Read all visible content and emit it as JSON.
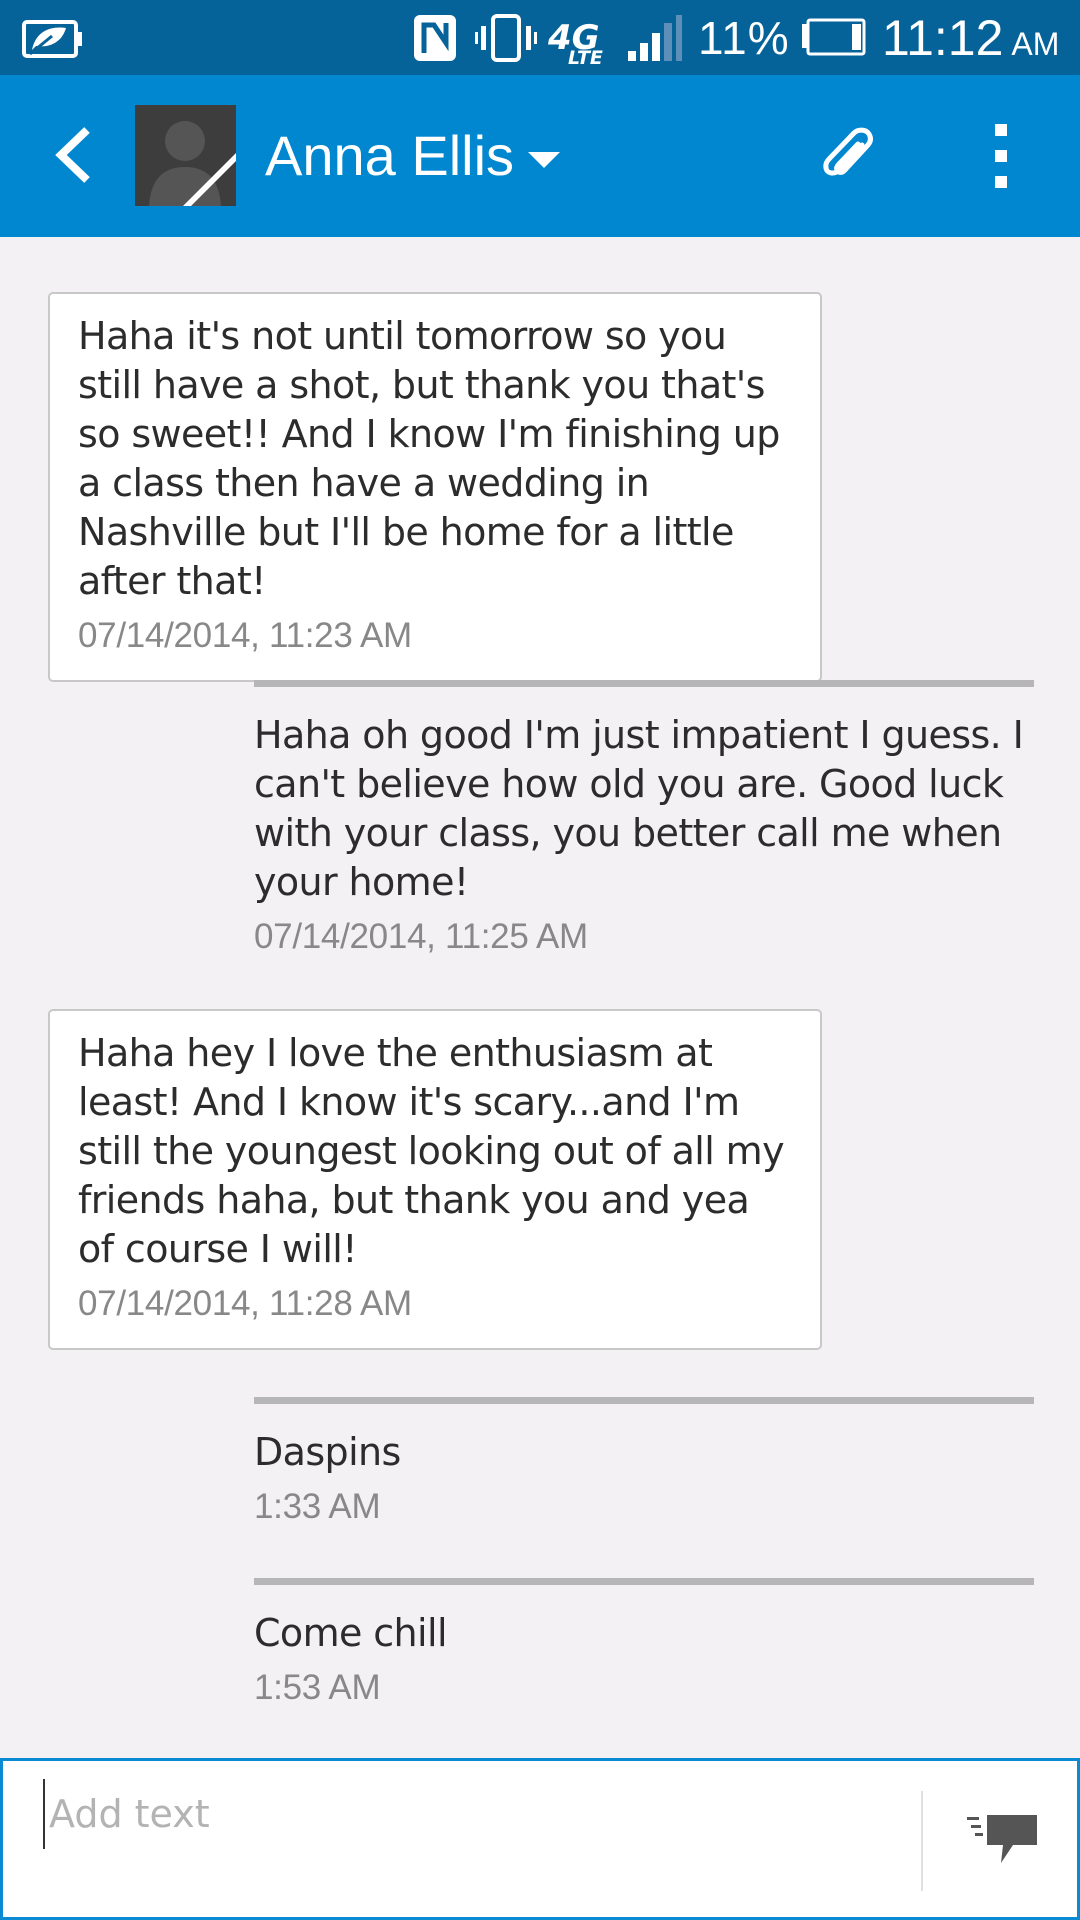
{
  "status_bar": {
    "battery_saver_icon": "battery-saver-leaf-icon",
    "nfc_icon": "nfc-icon",
    "vibrate_icon": "vibrate-icon",
    "network": "4G",
    "network_sub": "LTE",
    "signal_icon": "signal-bars-icon",
    "battery_percent": "11%",
    "battery_icon": "battery-icon",
    "time": "11:12",
    "ampm": "AM"
  },
  "app_bar": {
    "back_icon": "back-chevron-icon",
    "avatar_icon": "contact-avatar-placeholder",
    "contact_name": "Anna Ellis",
    "dropdown_icon": "caret-down-icon",
    "attach_icon": "paperclip-icon",
    "overflow_icon": "more-vertical-icon"
  },
  "messages": [
    {
      "direction": "incoming",
      "text": "Haha it's not until tomorrow so you still have a shot, but thank you that's so sweet!! And I know I'm finishing up a class then have a wedding in Nashville but I'll be home for a little after that!",
      "time": "07/14/2014, 11:23 AM"
    },
    {
      "direction": "outgoing",
      "text": "Haha oh good I'm just impatient I guess. I can't believe how old you are. Good luck with your class, you better call me when your home!",
      "time": "07/14/2014, 11:25 AM"
    },
    {
      "direction": "incoming",
      "text": "Haha hey I love the enthusiasm at least! And I know it's scary...and I'm still the youngest looking out of all my friends haha, but thank you and yea of course I will!",
      "time": "07/14/2014, 11:28 AM"
    },
    {
      "direction": "outgoing",
      "text": "Daspins",
      "time": "1:33 AM"
    },
    {
      "direction": "outgoing",
      "text": "Come chill",
      "time": "1:53 AM"
    }
  ],
  "compose": {
    "placeholder": "Add text",
    "value": "",
    "send_icon": "send-message-icon"
  },
  "colors": {
    "status_bar": "#06639a",
    "app_bar": "#0187d0",
    "background": "#f3f1f4",
    "compose_border": "#0a8ad2"
  }
}
